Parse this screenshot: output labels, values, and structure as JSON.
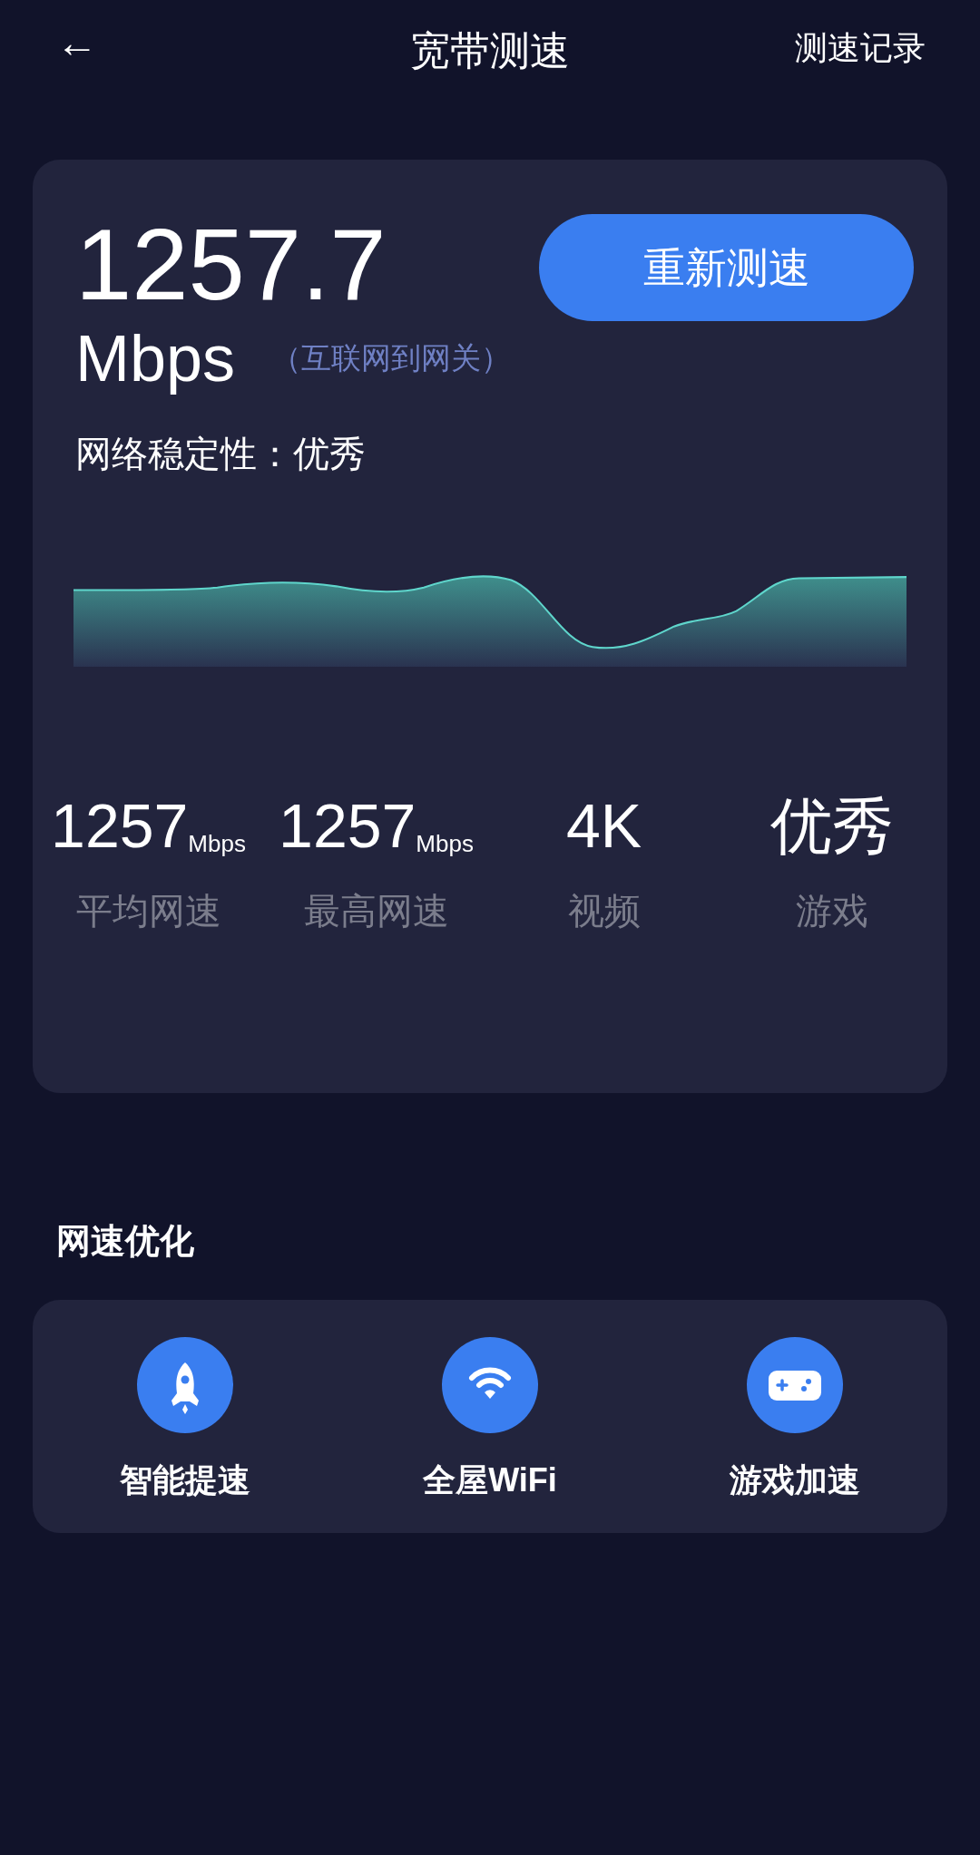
{
  "header": {
    "back": "←",
    "title": "宽带测速",
    "history_link": "测速记录"
  },
  "result": {
    "speed": "1257.7",
    "unit": "Mbps",
    "scope": "（互联网到网关）",
    "retest_button": "重新测速",
    "stability": "网络稳定性：优秀",
    "stats": [
      {
        "value": "1257",
        "unit": "Mbps",
        "label": "平均网速"
      },
      {
        "value": "1257",
        "unit": "Mbps",
        "label": "最高网速"
      },
      {
        "value": "4K",
        "label": "视频"
      },
      {
        "value": "优秀",
        "label": "游戏"
      }
    ]
  },
  "optimization": {
    "title": "网速优化",
    "actions": [
      {
        "kind": "rocket",
        "label": "智能提速"
      },
      {
        "kind": "wifi",
        "label": "全屋WiFi"
      },
      {
        "kind": "gamepad",
        "label": "游戏加速"
      }
    ]
  }
}
